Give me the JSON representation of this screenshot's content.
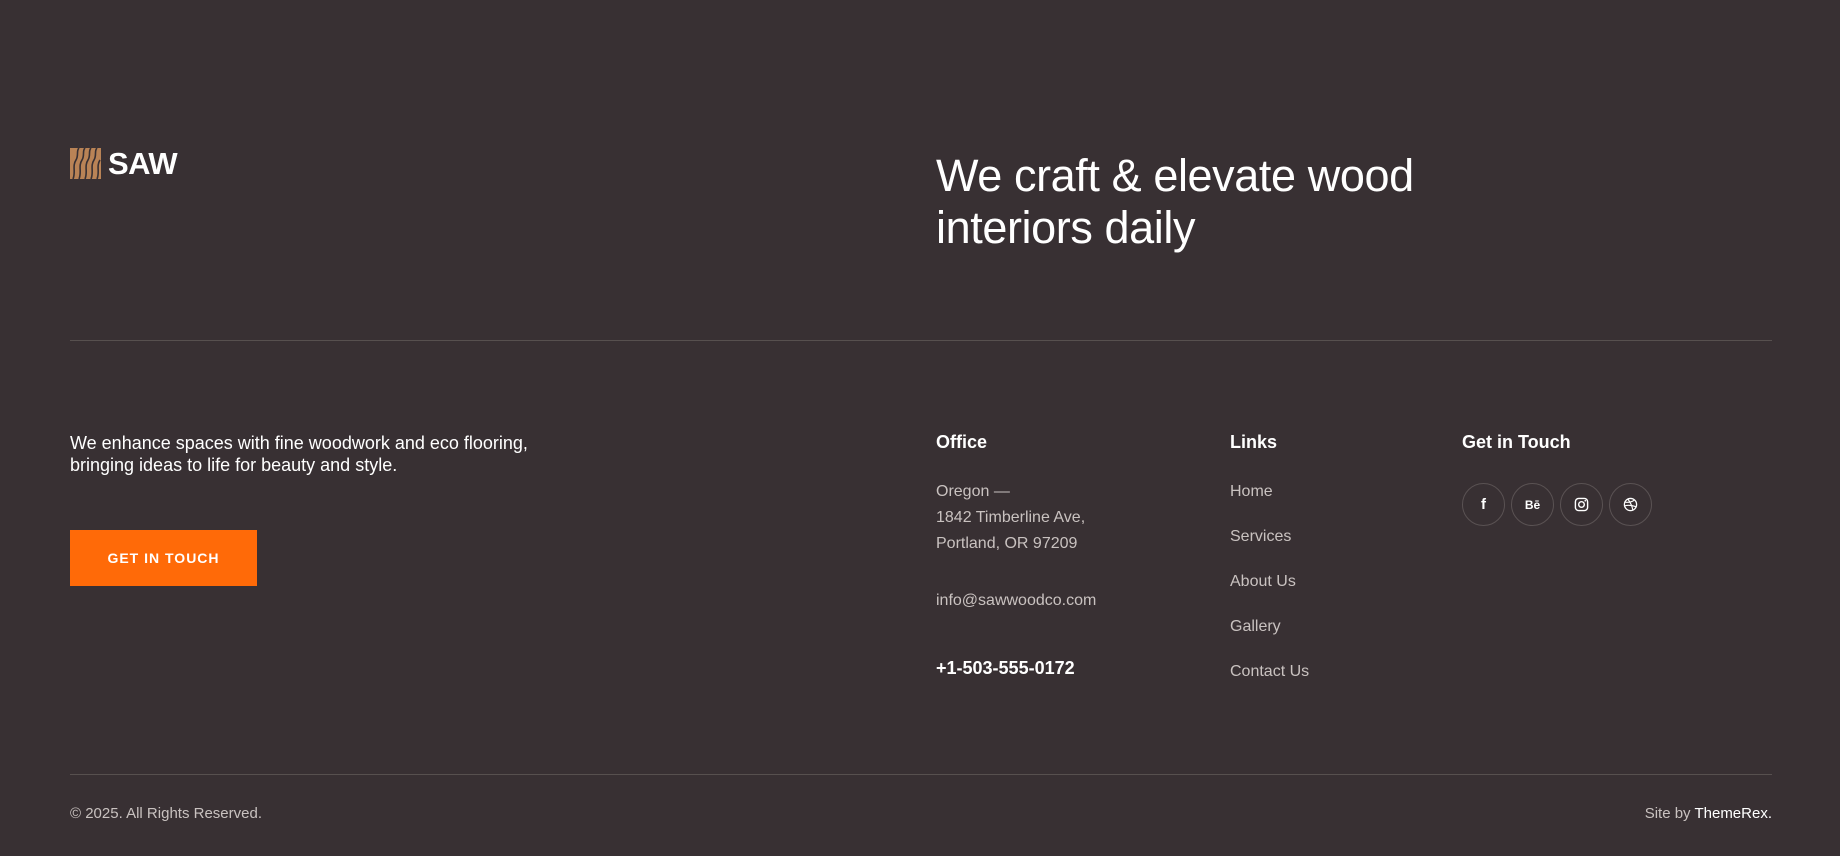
{
  "brand": {
    "name": "SAW",
    "logo_icon": "wood-grain-icon",
    "logo_color": "#b98356"
  },
  "headline": {
    "line1": "We craft & elevate wood",
    "line2": "interiors daily"
  },
  "about": {
    "tagline": "We enhance spaces with fine woodwork and eco flooring, bringing ideas to life for beauty and style.",
    "cta_label": "Get in touch"
  },
  "office": {
    "title": "Office",
    "address": [
      "Oregon —",
      "1842 Timberline Ave,",
      "Portland, OR 97209"
    ],
    "email": "info@sawwoodco.com",
    "phone": "+1-503-555-0172"
  },
  "links": {
    "title": "Links",
    "items": [
      "Home",
      "Services",
      "About Us",
      "Gallery",
      "Contact Us"
    ]
  },
  "touch": {
    "title": "Get in Touch",
    "socials": [
      {
        "icon": "facebook-icon",
        "label": "f"
      },
      {
        "icon": "behance-icon",
        "label": "Bē"
      },
      {
        "icon": "instagram-icon",
        "label": ""
      },
      {
        "icon": "dribbble-icon",
        "label": ""
      }
    ]
  },
  "bottom": {
    "copyright": "© 2025. All Rights Reserved.",
    "siteby_prefix": "Site by ",
    "siteby_link": "ThemeRex."
  },
  "colors": {
    "background": "#383033",
    "accent": "#ff6a08",
    "divider": "#57504f",
    "muted_text": "#c9c2c0"
  }
}
